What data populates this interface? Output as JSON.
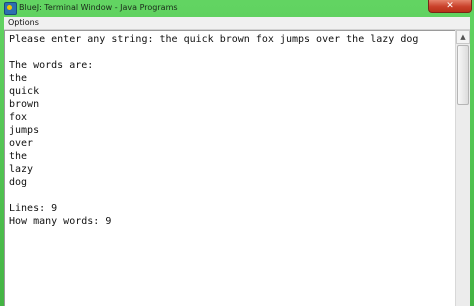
{
  "window": {
    "title": "BlueJ: Terminal Window - Java Programs",
    "close_glyph": "✕",
    "icon_name": "bluej-icon"
  },
  "menu": {
    "options_label": "Options"
  },
  "terminal": {
    "lines": [
      "Please enter any string: the quick brown fox jumps over the lazy dog",
      "",
      "The words are:",
      "the",
      "quick",
      "brown",
      "fox",
      "jumps",
      "over",
      "the",
      "lazy",
      "dog",
      "",
      "Lines: 9",
      "How many words: 9"
    ]
  },
  "scrollbar": {
    "up_glyph": "▲"
  }
}
